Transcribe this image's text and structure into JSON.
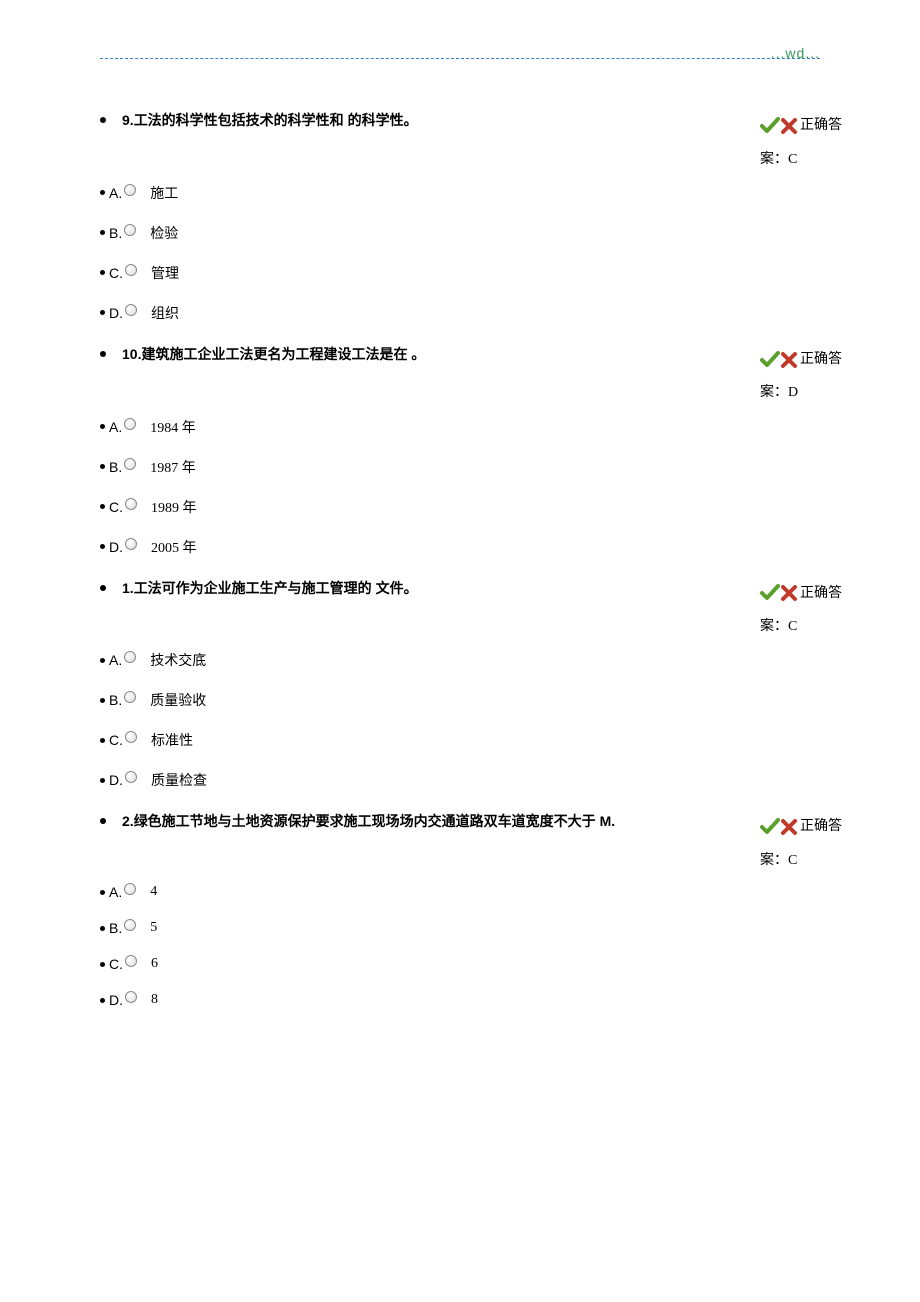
{
  "header_mark": "...wd...",
  "answer_label_prefix": "正确答",
  "answer_label_suffix": "案：",
  "questions": [
    {
      "number": "9.",
      "text": "工法的科学性包括技术的科学性和  的科学性。",
      "answer": "C",
      "options": [
        {
          "label": "A.",
          "text": "施工"
        },
        {
          "label": "B.",
          "text": "检验"
        },
        {
          "label": "C.",
          "text": "管理"
        },
        {
          "label": "D.",
          "text": "组织"
        }
      ]
    },
    {
      "number": "10.",
      "text": "建筑施工企业工法更名为工程建设工法是在  。",
      "answer": "D",
      "options": [
        {
          "label": "A.",
          "text": "1984 年"
        },
        {
          "label": "B.",
          "text": "1987 年"
        },
        {
          "label": "C.",
          "text": "1989 年"
        },
        {
          "label": "D.",
          "text": "2005 年"
        }
      ]
    },
    {
      "number": "1.",
      "text": "工法可作为企业施工生产与施工管理的  文件。",
      "answer": "C",
      "options": [
        {
          "label": "A.",
          "text": "技术交底"
        },
        {
          "label": "B.",
          "text": "质量验收"
        },
        {
          "label": "C.",
          "text": "标准性"
        },
        {
          "label": "D.",
          "text": "质量检查"
        }
      ]
    },
    {
      "number": "2.",
      "text": "绿色施工节地与土地资源保护要求施工现场场内交通道路双车道宽度不大于  M.",
      "answer": "C",
      "options": [
        {
          "label": "A.",
          "text": "4"
        },
        {
          "label": "B.",
          "text": "5"
        },
        {
          "label": "C.",
          "text": "6"
        },
        {
          "label": "D.",
          "text": "8"
        }
      ]
    }
  ]
}
